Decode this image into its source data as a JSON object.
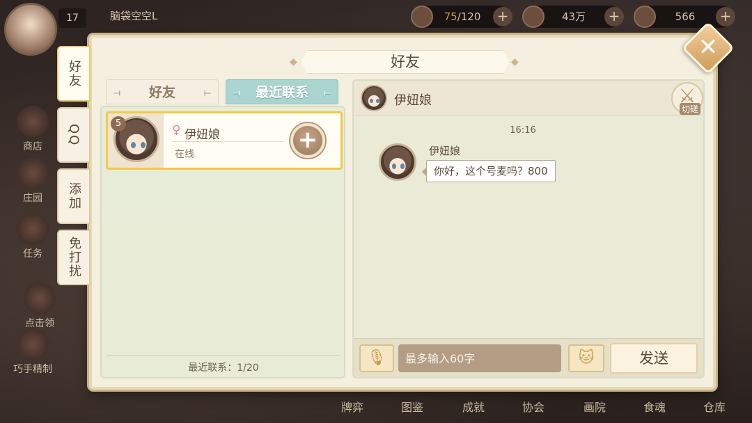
{
  "hud": {
    "level": "17",
    "player_name": "脑袋空空L",
    "stamina": {
      "current": "75",
      "max": "/120"
    },
    "copper": "43万",
    "jade": "566"
  },
  "left_menu": [
    {
      "label": "商店"
    },
    {
      "label": "庄园"
    },
    {
      "label": "任务"
    },
    {
      "label": "点击领"
    },
    {
      "label": "巧手精制"
    }
  ],
  "bottom_nav": [
    {
      "label": "牌弈"
    },
    {
      "label": "图鉴"
    },
    {
      "label": "成就"
    },
    {
      "label": "协会"
    },
    {
      "label": "画院"
    },
    {
      "label": "食魂"
    },
    {
      "label": "仓库"
    }
  ],
  "modal": {
    "title": "好友",
    "side_tabs": [
      "好友",
      "QQ",
      "添加",
      "免打扰"
    ],
    "tabs": {
      "friends": "好友",
      "recent": "最近联系"
    },
    "friend": {
      "level": "5",
      "name": "伊妞娘",
      "status": "在线"
    },
    "recent_count": "最近联系：1/20",
    "chat": {
      "title": "伊妞娘",
      "duel_label": "切磋",
      "time": "16:16",
      "sender": "伊妞娘",
      "message": "你好，这个号麦吗？800",
      "input_placeholder": "最多输入60字",
      "send_label": "发送"
    }
  },
  "icons": {
    "close": "close-icon",
    "add": "plus-icon",
    "mic": "microphone-icon",
    "emoji": "cat-face-icon",
    "female": "female-icon",
    "duel": "crossed-swords-icon"
  },
  "colors": {
    "accent_tab": "#a9d4d0",
    "highlight_border": "#f2c94c",
    "close_button": "#d09b5c"
  }
}
